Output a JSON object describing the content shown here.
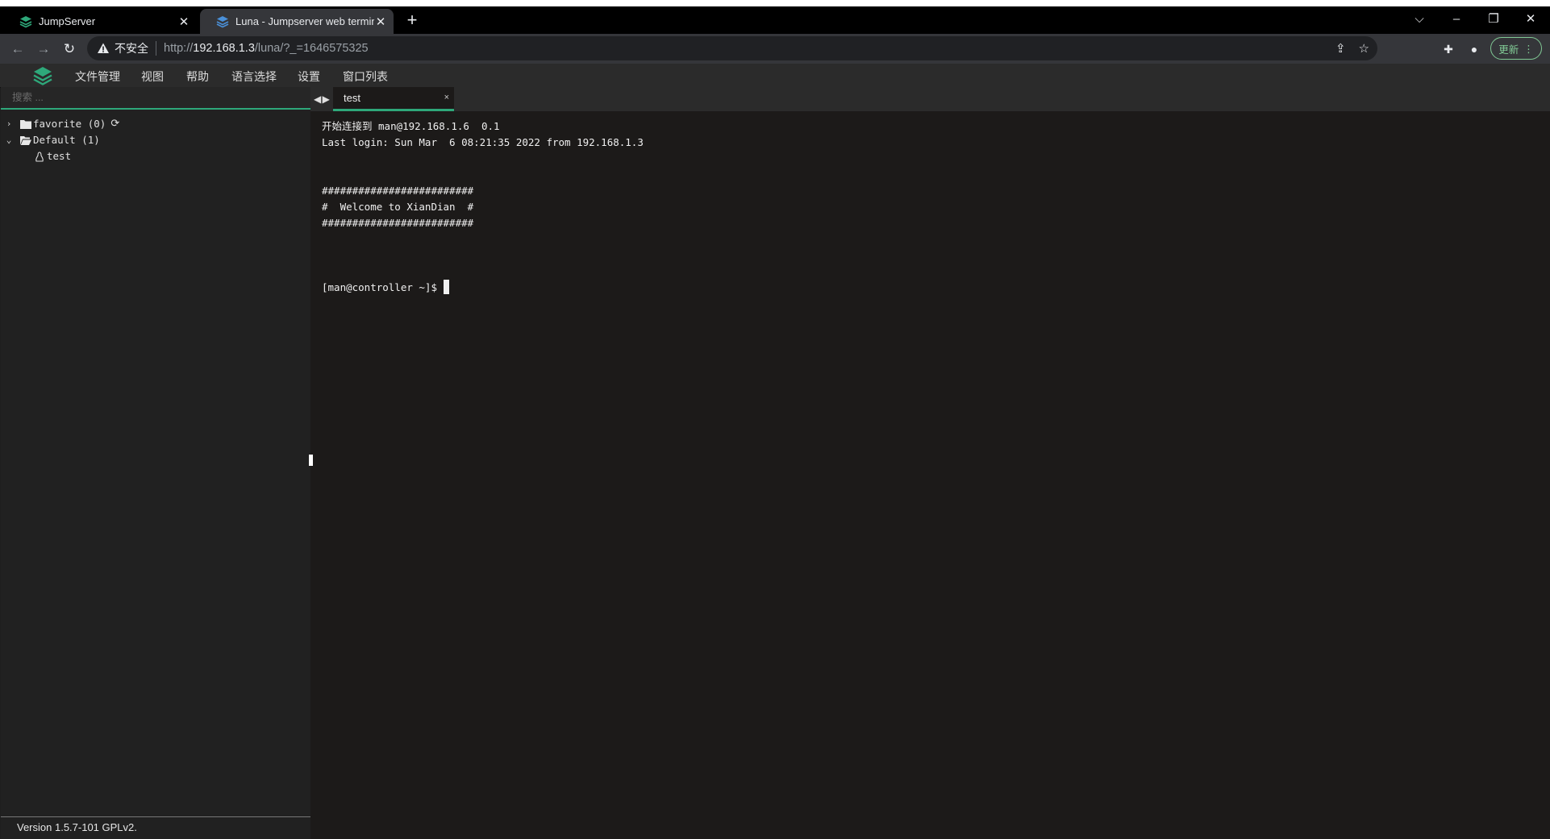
{
  "browser": {
    "tabs": [
      {
        "title": "JumpServer",
        "active": false
      },
      {
        "title": "Luna - Jumpserver web terminal",
        "active": true
      }
    ],
    "new_tab_label": "+",
    "address": {
      "security_label": "不安全",
      "url_scheme": "http://",
      "url_host": "192.168.1.3",
      "url_path": "/luna/?_=1646575325"
    },
    "update_label": "更新"
  },
  "app": {
    "menu": [
      "文件管理",
      "视图",
      "帮助",
      "语言选择",
      "设置",
      "窗口列表"
    ],
    "search_placeholder": "搜索 ...",
    "tree": {
      "favorite": {
        "label": "favorite (0)"
      },
      "default": {
        "label": "Default (1)"
      },
      "hosts": [
        {
          "label": "test"
        }
      ]
    },
    "version": "Version 1.5.7-101 GPLv2.",
    "terminal_tab": {
      "label": "test",
      "close": "×"
    },
    "terminal_lines": [
      "开始连接到 man@192.168.1.6  0.1",
      "Last login: Sun Mar  6 08:21:35 2022 from 192.168.1.3",
      "",
      "",
      "#########################",
      "#  Welcome to XianDian  #",
      "#########################",
      "",
      "",
      "",
      "[man@controller ~]$ "
    ]
  },
  "colors": {
    "accent": "#2ea87a",
    "terminal_bg": "#1c1a19",
    "sidebar_bg": "#212121"
  }
}
